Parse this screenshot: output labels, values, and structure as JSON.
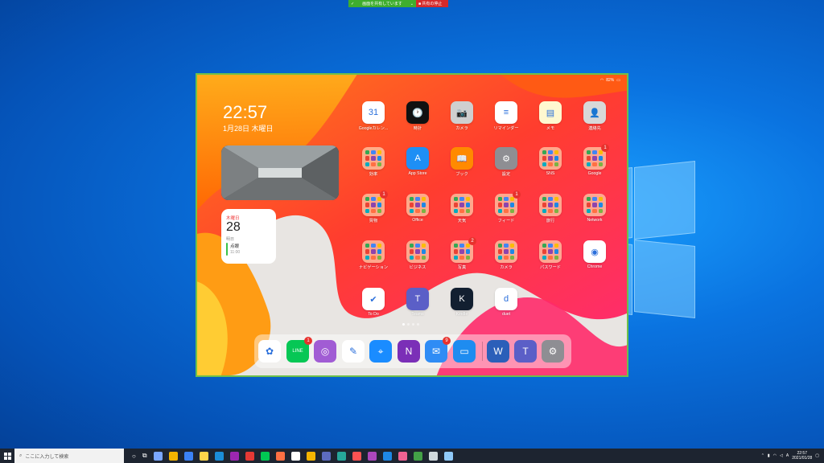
{
  "share_bar": {
    "label": "画面を共有しています",
    "stop_label": "共有の停止"
  },
  "ipad": {
    "battery": "82%",
    "time": "22:57",
    "date": "1月28日 木曜日",
    "calendar_widget": {
      "weekday": "木曜日",
      "day": "28",
      "tomorrow": "明日",
      "event": "点眼",
      "event_time": "11:00"
    },
    "apps": [
      {
        "name": "app-google-calendar",
        "label": "Googleカレン...",
        "color": "#ffffff",
        "glyph": "31",
        "badge": null
      },
      {
        "name": "app-clock",
        "label": "時計",
        "color": "#111111",
        "glyph": "🕐",
        "badge": null
      },
      {
        "name": "app-camera",
        "label": "カメラ",
        "color": "#cfcfcf",
        "glyph": "📷",
        "badge": null
      },
      {
        "name": "app-reminders",
        "label": "リマインダー",
        "color": "#ffffff",
        "glyph": "≡",
        "badge": null
      },
      {
        "name": "app-notes",
        "label": "メモ",
        "color": "#fff8d0",
        "glyph": "▤",
        "badge": null
      },
      {
        "name": "app-contacts",
        "label": "連絡先",
        "color": "#d8d8d8",
        "glyph": "👤",
        "badge": null
      },
      {
        "name": "folder-tools",
        "label": "効率",
        "color": "folder",
        "glyph": "",
        "badge": null
      },
      {
        "name": "app-app-store",
        "label": "App Store",
        "color": "#1e8ff5",
        "glyph": "A",
        "badge": null
      },
      {
        "name": "app-books",
        "label": "ブック",
        "color": "#ff8a00",
        "glyph": "📖",
        "badge": null
      },
      {
        "name": "app-settings",
        "label": "設定",
        "color": "#8e8e93",
        "glyph": "⚙",
        "badge": null
      },
      {
        "name": "folder-sns",
        "label": "SNS",
        "color": "folder",
        "glyph": "",
        "badge": null
      },
      {
        "name": "folder-google",
        "label": "Google",
        "color": "folder",
        "glyph": "",
        "badge": "1"
      },
      {
        "name": "folder-shopping",
        "label": "買物",
        "color": "folder",
        "glyph": "",
        "badge": "1"
      },
      {
        "name": "folder-office",
        "label": "Office",
        "color": "folder",
        "glyph": "",
        "badge": null
      },
      {
        "name": "folder-weather",
        "label": "天気",
        "color": "folder",
        "glyph": "",
        "badge": null
      },
      {
        "name": "folder-feed",
        "label": "フィード",
        "color": "folder",
        "glyph": "",
        "badge": "1"
      },
      {
        "name": "folder-travel",
        "label": "旅行",
        "color": "folder",
        "glyph": "",
        "badge": null
      },
      {
        "name": "folder-network",
        "label": "Network",
        "color": "folder",
        "glyph": "",
        "badge": null
      },
      {
        "name": "folder-navigation",
        "label": "ナビゲーション",
        "color": "folder",
        "glyph": "",
        "badge": null
      },
      {
        "name": "folder-business",
        "label": "ビジネス",
        "color": "folder",
        "glyph": "",
        "badge": null
      },
      {
        "name": "folder-photos",
        "label": "写真",
        "color": "folder",
        "glyph": "",
        "badge": "2"
      },
      {
        "name": "folder-camera",
        "label": "カメラ",
        "color": "folder",
        "glyph": "",
        "badge": null
      },
      {
        "name": "folder-passwords",
        "label": "パスワード",
        "color": "folder",
        "glyph": "",
        "badge": null
      },
      {
        "name": "app-chrome",
        "label": "Chrome",
        "color": "#ffffff",
        "glyph": "◉",
        "badge": null
      },
      {
        "name": "app-todo",
        "label": "To Do",
        "color": "#ffffff",
        "glyph": "✔",
        "badge": null
      },
      {
        "name": "app-teams",
        "label": "Teams",
        "color": "#5b5fc7",
        "glyph": "T",
        "badge": null
      },
      {
        "name": "app-kindle",
        "label": "Kindle",
        "color": "#121f30",
        "glyph": "K",
        "badge": null
      },
      {
        "name": "app-duet",
        "label": "duet",
        "color": "#ffffff",
        "glyph": "d",
        "badge": null
      }
    ],
    "dock": [
      {
        "name": "dock-photos",
        "color": "#ffffff",
        "glyph": "✿",
        "badge": null
      },
      {
        "name": "dock-line",
        "color": "#06c755",
        "glyph": "LINE",
        "badge": "1"
      },
      {
        "name": "dock-podcasts",
        "color": "#a15cd4",
        "glyph": "◎",
        "badge": null
      },
      {
        "name": "dock-notes-pen",
        "color": "#ffffff",
        "glyph": "✎",
        "badge": null
      },
      {
        "name": "dock-safari",
        "color": "#1a8cff",
        "glyph": "⌖",
        "badge": null
      },
      {
        "name": "dock-onenote",
        "color": "#7b2fb7",
        "glyph": "N",
        "badge": null
      },
      {
        "name": "dock-mail",
        "color": "#2f8cf5",
        "glyph": "✉",
        "badge": "9"
      },
      {
        "name": "dock-files",
        "color": "#1e8cf0",
        "glyph": "▭",
        "badge": null
      },
      {
        "name": "dock-word",
        "color": "#2b5fb9",
        "glyph": "W",
        "badge": null
      },
      {
        "name": "dock-teams",
        "color": "#5b5fc7",
        "glyph": "T",
        "badge": null
      },
      {
        "name": "dock-settings",
        "color": "#8e8e93",
        "glyph": "⚙",
        "badge": null
      }
    ]
  },
  "taskbar": {
    "search_placeholder": "ここに入力して検索",
    "clock_time": "22:57",
    "clock_date": "2021/01/28",
    "icons": [
      "#7aa7ff",
      "#f4b400",
      "#3b82f6",
      "#ffd54a",
      "#1b8dd9",
      "#9c27b0",
      "#e53935",
      "#00c853",
      "#ff7043",
      "#ffffff",
      "#f4b400",
      "#5c6bc0",
      "#26a69a",
      "#ff5252",
      "#ab47bc",
      "#1e88e5",
      "#f06292",
      "#43a047",
      "#cfd8dc",
      "#90caf9"
    ]
  }
}
